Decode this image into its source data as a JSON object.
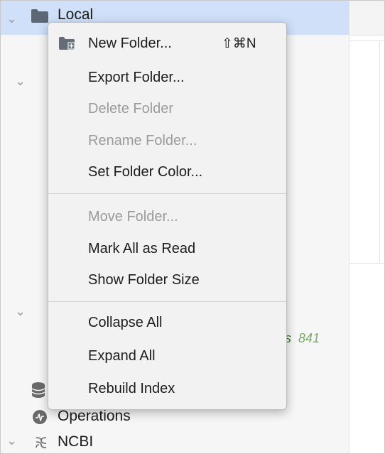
{
  "sidebar": {
    "rows": {
      "local": "Local",
      "operations": "Operations",
      "ncbi": "NCBI"
    },
    "peek": {
      "text": "res",
      "count": "841"
    }
  },
  "context_menu": {
    "items": [
      {
        "label": "New Folder...",
        "shortcut": "⇧⌘N",
        "enabled": true
      },
      {
        "label": "Export Folder...",
        "enabled": true
      },
      {
        "label": "Delete Folder",
        "enabled": false
      },
      {
        "label": "Rename Folder...",
        "enabled": false
      },
      {
        "label": "Set Folder Color...",
        "enabled": true
      },
      {
        "label": "Move Folder...",
        "enabled": false
      },
      {
        "label": "Mark All as Read",
        "enabled": true
      },
      {
        "label": "Show Folder Size",
        "enabled": true
      },
      {
        "label": "Collapse All",
        "enabled": true
      },
      {
        "label": "Expand All",
        "enabled": true
      },
      {
        "label": "Rebuild Index",
        "enabled": true
      }
    ]
  },
  "colors": {
    "selection": "#cfe0f8",
    "menu_background": "#f2f2f2",
    "disabled_text": "#9b9b9b",
    "peek_text": "#2d6f1a"
  },
  "icons": {
    "folder": "folder-icon",
    "new_folder": "new-folder-icon",
    "operations": "operations-icon",
    "ncbi": "ncbi-icon",
    "database": "database-icon",
    "chevron": "chevron-down-icon"
  }
}
